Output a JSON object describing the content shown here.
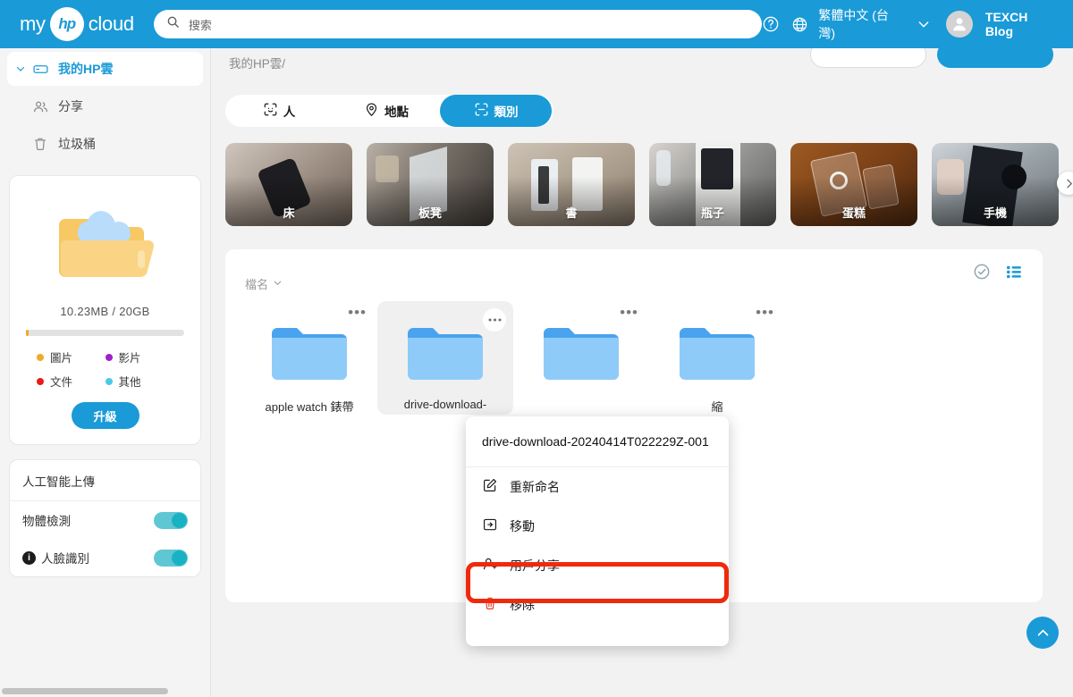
{
  "header": {
    "logo_my": "my",
    "logo_hp": "hp",
    "logo_cloud": "cloud",
    "search_placeholder": "搜索",
    "search_value": "",
    "help_icon": "help-circle-icon",
    "globe_icon": "globe-icon",
    "language": "繁體中文 (台灣)",
    "chevron_icon": "chevron-down-icon",
    "user_name": "TEXCH Blog",
    "accent_color": "#1a9ad7"
  },
  "sidebar": {
    "items": [
      {
        "label": "我的HP雲",
        "icon": "drive-icon",
        "active": true
      },
      {
        "label": "分享",
        "icon": "share-people-icon",
        "active": false
      },
      {
        "label": "垃圾桶",
        "icon": "trash-icon",
        "active": false
      }
    ],
    "storage": {
      "icon": "cloud-folder-icon",
      "used_total": "10.23MB / 20GB",
      "legend": [
        {
          "label": "圖片",
          "color": "#f0a92a"
        },
        {
          "label": "影片",
          "color": "#a020d0"
        },
        {
          "label": "文件",
          "color": "#e81a1a"
        },
        {
          "label": "其他",
          "color": "#4cc9e8"
        }
      ],
      "upgrade_label": "升級"
    },
    "ai": {
      "title": "人工智能上傳",
      "rows": [
        {
          "label": "物體檢測",
          "info": false,
          "enabled": true
        },
        {
          "label": "人臉識別",
          "info": true,
          "enabled": true
        }
      ]
    }
  },
  "main": {
    "breadcrumb": "我的HP雲/",
    "top_buttons": [
      {
        "label": "",
        "style": "outline"
      },
      {
        "label": "",
        "style": "filled"
      }
    ],
    "tabs": [
      {
        "label": "人",
        "icon": "face-scan-icon",
        "active": false
      },
      {
        "label": "地點",
        "icon": "location-pin-icon",
        "active": false
      },
      {
        "label": "類別",
        "icon": "category-scan-icon",
        "active": true
      }
    ],
    "categories": [
      {
        "label": "床"
      },
      {
        "label": "板凳"
      },
      {
        "label": "書"
      },
      {
        "label": "瓶子"
      },
      {
        "label": "蛋糕"
      },
      {
        "label": "手機"
      }
    ],
    "carousel_next_icon": "chevron-right-icon",
    "files": {
      "sort_label": "檔名",
      "sort_chevron_icon": "chevron-down-icon",
      "select_icon": "check-circle-icon",
      "view_icon": "list-view-icon",
      "items": [
        {
          "name": "apple watch 錶帶",
          "icon": "folder-icon",
          "selected": false
        },
        {
          "name": "drive-download-",
          "icon": "folder-icon",
          "selected": true
        },
        {
          "name": "",
          "icon": "folder-icon",
          "selected": false
        },
        {
          "name": "縮",
          "icon": "folder-icon",
          "selected": false
        }
      ],
      "menu_dots_icon": "more-horizontal-icon"
    },
    "context_menu": {
      "title": "drive-download-20240414T022229Z-001",
      "items": [
        {
          "label": "重新命名",
          "icon": "rename-icon",
          "highlighted": false
        },
        {
          "label": "移動",
          "icon": "move-folder-icon",
          "highlighted": false
        },
        {
          "label": "用戶分享",
          "icon": "user-add-icon",
          "highlighted": true
        },
        {
          "label": "移除",
          "icon": "trash-red-icon",
          "highlighted": false
        }
      ],
      "highlight_color": "#ef2a0c"
    },
    "scroll_top_icon": "chevron-up-icon"
  }
}
